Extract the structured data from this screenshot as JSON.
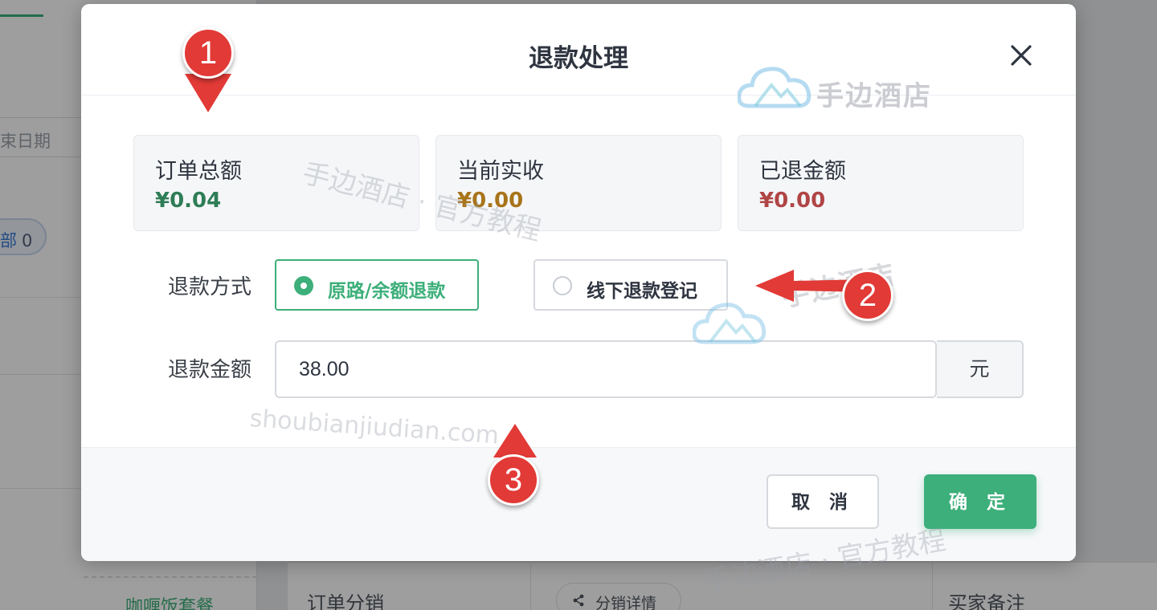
{
  "background": {
    "date_placeholder_fragment": "束日期",
    "badge": {
      "prefix": "部",
      "count": "0"
    },
    "meal_item": "咖喱饭套餐",
    "order_distribution": "订单分销",
    "distribution_detail_button": "分销详情",
    "buyer_note": "买家备注"
  },
  "dialog": {
    "title": "退款处理",
    "stats": [
      {
        "label": "订单总额",
        "value": "¥0.04",
        "color": "#2e7d56"
      },
      {
        "label": "当前实收",
        "value": "¥0.00",
        "color": "#a8741a"
      },
      {
        "label": "已退金额",
        "value": "¥0.00",
        "color": "#b04545"
      }
    ],
    "refund_method": {
      "label": "退款方式",
      "options": [
        {
          "label": "原路/余额退款",
          "selected": true
        },
        {
          "label": "线下退款登记",
          "selected": false
        }
      ]
    },
    "refund_amount": {
      "label": "退款金额",
      "value": "38.00",
      "unit": "元"
    },
    "buttons": {
      "cancel": "取 消",
      "confirm": "确 定"
    }
  },
  "watermarks": {
    "brand": "手边酒店",
    "tagline": "手边酒店 · 官方教程",
    "url": "shoubianjiudian.com"
  },
  "annotations": [
    "1",
    "2",
    "3"
  ],
  "colors": {
    "accent": "#3daf7a",
    "marker": "#e23a36"
  }
}
